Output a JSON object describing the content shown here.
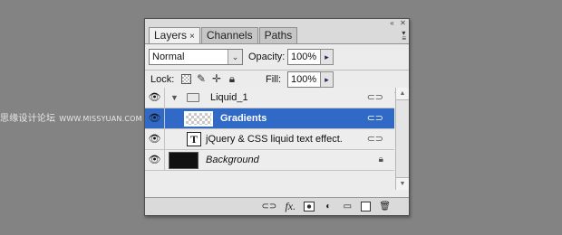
{
  "watermark": {
    "text": "思缘设计论坛",
    "url": "WWW.MISSYUAN.COM"
  },
  "window": {
    "minimize_label": "«",
    "close_label": "✕"
  },
  "tabs": [
    {
      "label": "Layers",
      "close": "×"
    },
    {
      "label": "Channels"
    },
    {
      "label": "Paths"
    }
  ],
  "panel_menu_icon": "menu-icon",
  "blend_mode": {
    "value": "Normal",
    "arrow": "⌄"
  },
  "opacity": {
    "label": "Opacity:",
    "value": "100%",
    "arrow": "▸"
  },
  "lock": {
    "label": "Lock:",
    "icons": [
      "transparency-lock-icon",
      "brush-icon",
      "move-icon",
      "lock-icon"
    ]
  },
  "fill": {
    "label": "Fill:",
    "value": "100%",
    "arrow": "▸"
  },
  "layers": [
    {
      "name": "Liquid_1",
      "type": "group",
      "visible": true,
      "expanded": true
    },
    {
      "name": "Gradients",
      "type": "pixel",
      "visible": true,
      "selected": true
    },
    {
      "name": "jQuery & CSS liquid text effect.",
      "type": "text",
      "visible": true,
      "thumb": "T"
    },
    {
      "name": "Background",
      "type": "background",
      "visible": true,
      "locked": true
    }
  ],
  "bottom_icons": [
    "link-icon",
    "fx-icon",
    "mask-icon",
    "adjustment-icon",
    "new-group-icon",
    "new-layer-icon",
    "trash-icon"
  ],
  "bottom_labels": {
    "fx": "fx."
  },
  "colors": {
    "selection": "#3169c6",
    "panel": "#ececec",
    "background": "#838383"
  }
}
